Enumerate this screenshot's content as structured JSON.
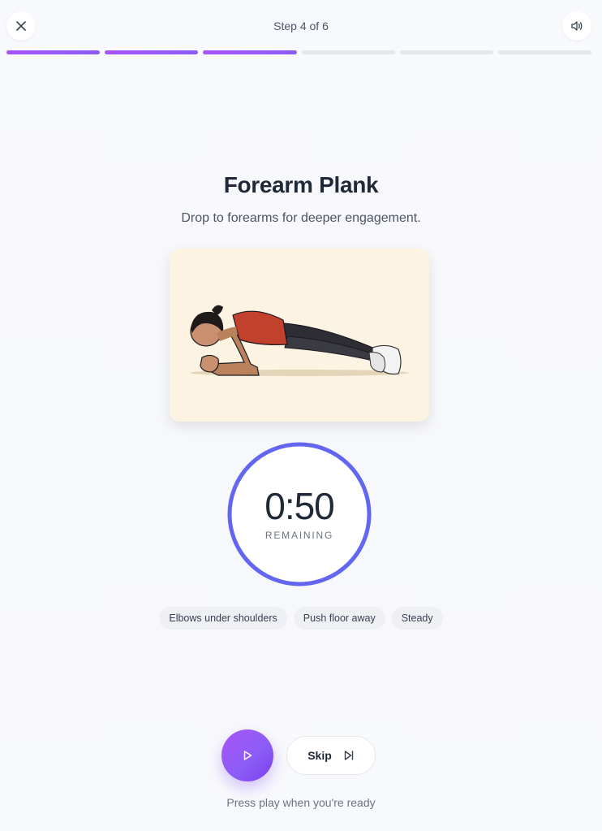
{
  "header": {
    "step_label": "Step 4 of 6",
    "close_icon": "close-icon",
    "sound_icon": "volume-icon"
  },
  "progress": {
    "total_steps": 6,
    "completed_steps": 3,
    "active_color": "#a855f7",
    "inactive_color": "#e5e7eb"
  },
  "exercise": {
    "title": "Forearm Plank",
    "description": "Drop to forearms for deeper engagement."
  },
  "timer": {
    "time": "0:50",
    "label": "REMAINING",
    "ring_color": "#6366f1"
  },
  "tips": [
    "Elbows under shoulders",
    "Push floor away",
    "Steady"
  ],
  "controls": {
    "play_icon": "play-icon",
    "skip_label": "Skip",
    "skip_icon": "skip-forward-icon",
    "hint": "Press play when you're ready"
  },
  "colors": {
    "accent": "#8b5cf6",
    "background": "#f8f9fc"
  }
}
